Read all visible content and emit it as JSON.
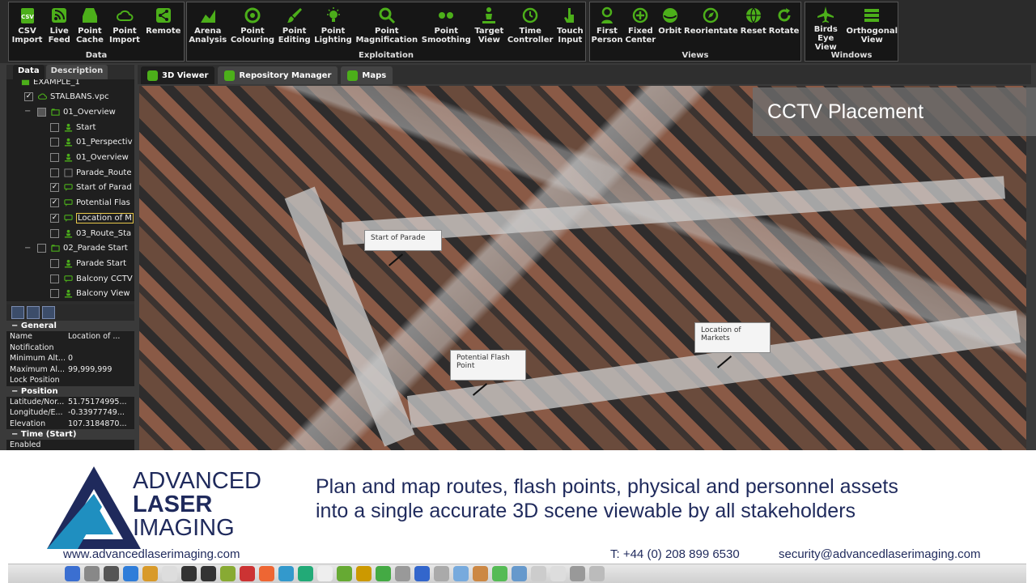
{
  "ribbon": {
    "groups": [
      {
        "label": "Data",
        "items": [
          {
            "label": "CSV\nImport",
            "icon": "csv-icon"
          },
          {
            "label": "Live\nFeed",
            "icon": "rss-icon"
          },
          {
            "label": "Point\nCache",
            "icon": "disk-icon"
          },
          {
            "label": "Point\nImport",
            "icon": "cloud-icon"
          },
          {
            "label": "Remote",
            "icon": "share-icon"
          }
        ]
      },
      {
        "label": "Exploitation",
        "items": [
          {
            "label": "Arena\nAnalysis",
            "icon": "chart-icon"
          },
          {
            "label": "Point\nColouring",
            "icon": "palette-icon"
          },
          {
            "label": "Point\nEditing",
            "icon": "brush-icon"
          },
          {
            "label": "Point\nLighting",
            "icon": "bulb-icon"
          },
          {
            "label": "Point\nMagnification",
            "icon": "magnifier-icon"
          },
          {
            "label": "Point\nSmoothing",
            "icon": "smoothing-icon"
          },
          {
            "label": "Target\nView",
            "icon": "target-person-icon"
          },
          {
            "label": "Time\nController",
            "icon": "clock-icon"
          },
          {
            "label": "Touch\nInput",
            "icon": "hand-icon"
          }
        ]
      },
      {
        "label": "Views",
        "items": [
          {
            "label": "First\nPerson",
            "icon": "person-icon"
          },
          {
            "label": "Fixed\nCenter",
            "icon": "plus-circle-icon"
          },
          {
            "label": "Orbit",
            "icon": "orbit-icon"
          },
          {
            "label": "Reorientate",
            "icon": "compass-icon"
          },
          {
            "label": "Reset",
            "icon": "globe-icon"
          },
          {
            "label": "Rotate",
            "icon": "rotate-icon"
          }
        ]
      },
      {
        "label": "Windows",
        "items": [
          {
            "label": "Birds Eye\nView",
            "icon": "plane-icon"
          },
          {
            "label": "Orthogonal\nView",
            "icon": "bars-icon"
          }
        ]
      }
    ]
  },
  "left_panel": {
    "tabs": [
      "Data",
      "Description"
    ],
    "tree": [
      {
        "label": "EXAMPLE_1",
        "indent": 0,
        "kind": "root",
        "checked": null
      },
      {
        "label": "STALBANS.vpc",
        "indent": 1,
        "kind": "cloud",
        "checked": true
      },
      {
        "label": "01_Overview",
        "indent": 1,
        "kind": "folder",
        "checked": "partial",
        "expander": "−"
      },
      {
        "label": "Start",
        "indent": 2,
        "kind": "person",
        "checked": false
      },
      {
        "label": "01_Perspectiv",
        "indent": 2,
        "kind": "person",
        "checked": false
      },
      {
        "label": "01_Overview",
        "indent": 2,
        "kind": "person",
        "checked": false
      },
      {
        "label": "Parade_Route",
        "indent": 2,
        "kind": "route",
        "checked": false
      },
      {
        "label": "Start of Parad",
        "indent": 2,
        "kind": "callout",
        "checked": true
      },
      {
        "label": "Potential Flas",
        "indent": 2,
        "kind": "callout",
        "checked": true
      },
      {
        "label": "Location of M",
        "indent": 2,
        "kind": "callout",
        "checked": true,
        "selected": true
      },
      {
        "label": "03_Route_Sta",
        "indent": 2,
        "kind": "person",
        "checked": false
      },
      {
        "label": "02_Parade Start",
        "indent": 1,
        "kind": "folder",
        "checked": false,
        "expander": "−"
      },
      {
        "label": "Parade Start",
        "indent": 2,
        "kind": "person",
        "checked": false
      },
      {
        "label": "Balcony CCTV",
        "indent": 2,
        "kind": "callout",
        "checked": false
      },
      {
        "label": "Balcony View",
        "indent": 2,
        "kind": "person",
        "checked": false
      }
    ],
    "properties": [
      {
        "section": "General",
        "rows": [
          [
            "Name",
            "Location of ..."
          ],
          [
            "Notification",
            ""
          ],
          [
            "Minimum Alt...",
            "0"
          ],
          [
            "Maximum Al...",
            "99,999,999"
          ],
          [
            "Lock Position",
            ""
          ]
        ]
      },
      {
        "section": "Position",
        "rows": [
          [
            "Latitude/Nor...",
            "51.75174995..."
          ],
          [
            "Longitude/E...",
            "-0.33977749..."
          ],
          [
            "Elevation",
            "107.3184870..."
          ]
        ]
      },
      {
        "section": "Time (Start)",
        "rows": [
          [
            "Enabled",
            ""
          ]
        ]
      }
    ]
  },
  "viewer": {
    "tabs": [
      {
        "label": "3D Viewer",
        "active": true
      },
      {
        "label": "Repository Manager",
        "active": false
      },
      {
        "label": "Maps",
        "active": false
      }
    ],
    "overlay_title": "CCTV Placement",
    "callouts": [
      "Start of Parade",
      "Potential Flash\nPoint",
      "Location of\nMarkets"
    ]
  },
  "banner": {
    "brand_line1": "ADVANCED",
    "brand_line2": "LASER",
    "brand_line3": "IMAGING",
    "tagline_line1": "Plan and map routes, flash points, physical and personnel assets",
    "tagline_line2": "into a single accurate 3D scene viewable by all stakeholders",
    "website": "www.advancedlaserimaging.com",
    "phone": "T: +44 (0) 208 899 6530",
    "email": "security@advancedlaserimaging.com"
  },
  "colors": {
    "accent_green": "#4caf1a",
    "brand_navy": "#1f2a5c",
    "brand_teal": "#1f8fc0"
  }
}
